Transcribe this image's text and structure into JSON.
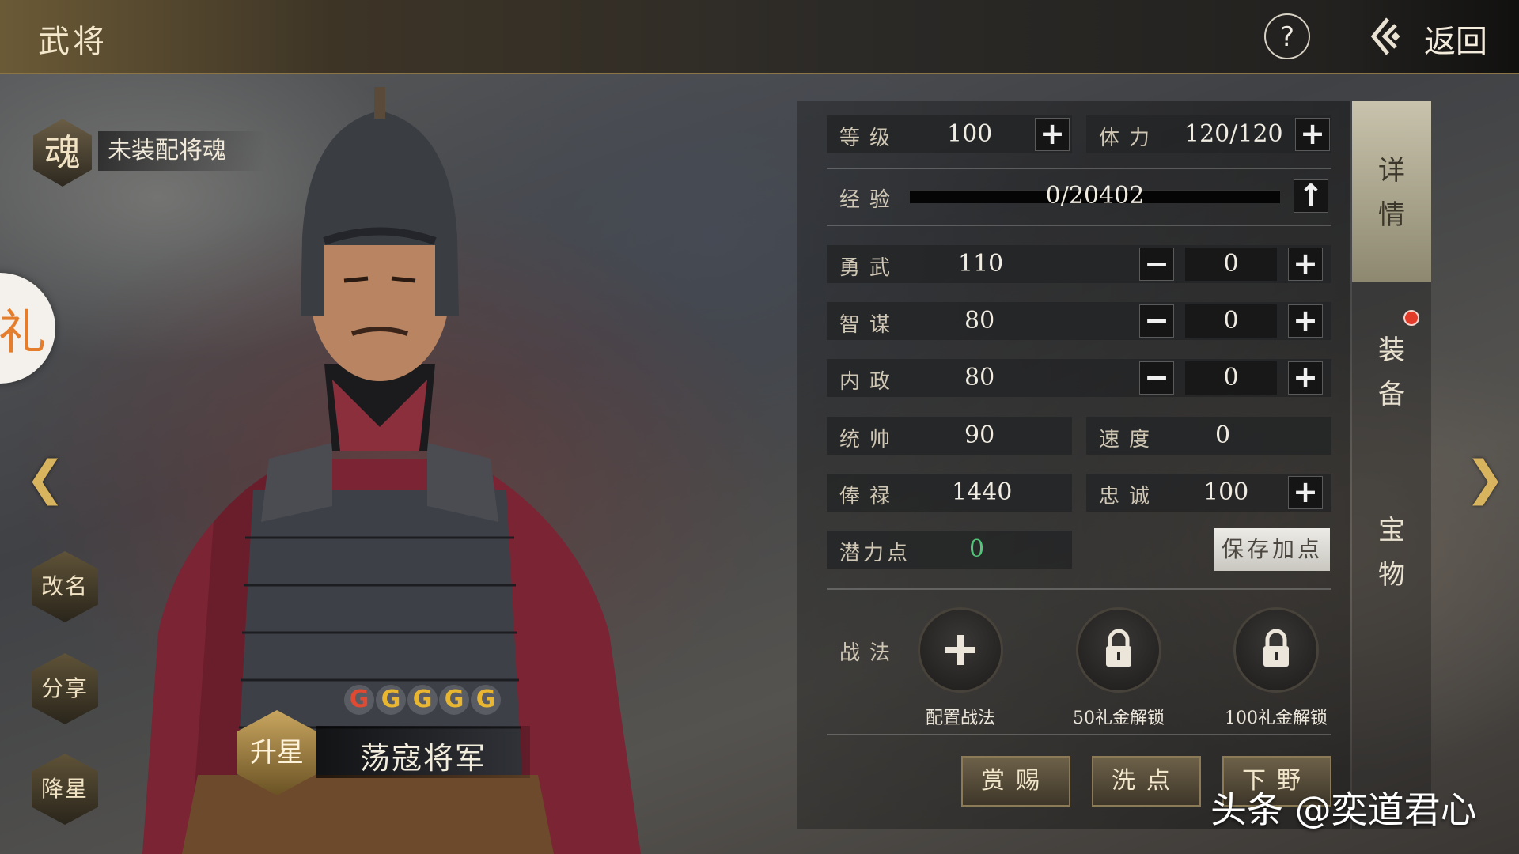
{
  "header": {
    "title": "武将",
    "help_label": "?",
    "back_label": "返回"
  },
  "soul": {
    "badge": "魂",
    "status": "未装配将魂"
  },
  "side_badge_glyph": "礼",
  "nav": {
    "prev": "❮",
    "next": "❯"
  },
  "left_actions": {
    "rename": "改名",
    "share": "分享",
    "downgrade": "降星"
  },
  "general": {
    "name": "荡寇将军",
    "upgrade_label": "升星",
    "stars": [
      "G",
      "G",
      "G",
      "G",
      "G"
    ],
    "star_colors": [
      "#e04a32",
      "#e8b630",
      "#e8b630",
      "#e8b630",
      "#e8b630"
    ]
  },
  "stats": {
    "level": {
      "label": "等级",
      "value": "100"
    },
    "stamina": {
      "label": "体力",
      "value": "120/120"
    },
    "exp": {
      "label": "经验",
      "value": "0/20402",
      "progress": 0
    },
    "valor": {
      "label": "勇武",
      "value": "110",
      "alloc": "0"
    },
    "strategy": {
      "label": "智谋",
      "value": "80",
      "alloc": "0"
    },
    "politics": {
      "label": "内政",
      "value": "80",
      "alloc": "0"
    },
    "command": {
      "label": "统帅",
      "value": "90"
    },
    "speed": {
      "label": "速度",
      "value": "0"
    },
    "salary": {
      "label": "俸禄",
      "value": "1440"
    },
    "loyalty": {
      "label": "忠诚",
      "value": "100"
    },
    "potential": {
      "label": "潜力点",
      "value": "0"
    },
    "plus": "+",
    "minus": "−",
    "up_arrow": "↑"
  },
  "save_label": "保存加点",
  "tactics": {
    "label": "战法",
    "slots": [
      {
        "caption": "配置战法",
        "icon": "plus-icon"
      },
      {
        "caption": "50礼金解锁",
        "icon": "lock-icon"
      },
      {
        "caption": "100礼金解锁",
        "icon": "lock-icon"
      }
    ]
  },
  "bottom_buttons": {
    "reward": "赏赐",
    "reset": "洗点",
    "dismiss": "下野"
  },
  "tabs": {
    "detail": [
      "详",
      "情"
    ],
    "equipment": [
      "装",
      "备"
    ],
    "treasure": [
      "宝",
      "物"
    ]
  },
  "watermark": "头条 @奕道君心",
  "colors": {
    "accent_gold": "#d8b45e",
    "potential_green": "#53c47a",
    "alert_red": "#e23b2a"
  }
}
